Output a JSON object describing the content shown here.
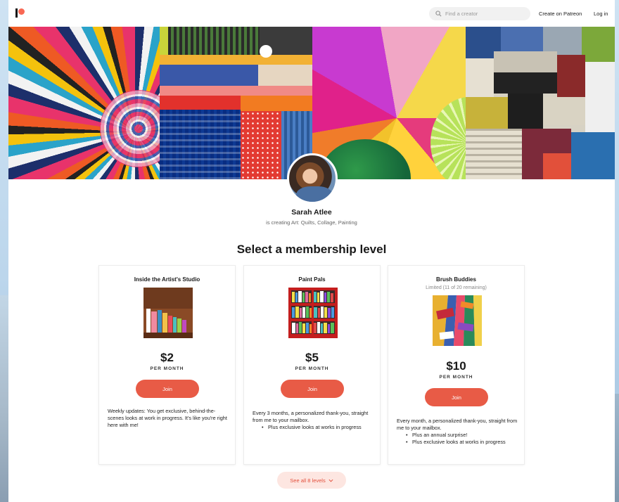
{
  "header": {
    "search_placeholder": "Find a creator",
    "create_label": "Create on Patreon",
    "login_label": "Log in"
  },
  "creator": {
    "name": "Sarah Atlee",
    "tagline": "is creating Art: Quilts, Collage, Painting"
  },
  "section_title": "Select a membership level",
  "tiers": [
    {
      "name": "Inside the Artist's Studio",
      "limited": "",
      "price": "$2",
      "per": "PER MONTH",
      "join": "Join",
      "description": "Weekly updates: You get exclusive, behind-the-scenes looks at work in progress. It's like you're right here with me!",
      "bullets": []
    },
    {
      "name": "Paint Pals",
      "limited": "",
      "price": "$5",
      "per": "PER MONTH",
      "join": "Join",
      "description": "Every 3 months, a personalized thank-you, straight from me to your mailbox.",
      "bullets": [
        "Plus exclusive looks at works in progress"
      ]
    },
    {
      "name": "Brush Buddies",
      "limited": "Limited (11 of 20 remaining)",
      "price": "$10",
      "per": "PER MONTH",
      "join": "Join",
      "description": "Every month, a personalized thank-you, straight from me to your mailbox.",
      "bullets": [
        "Plus an annual surprise!",
        "Plus exclusive looks at works in progress"
      ]
    }
  ],
  "see_all_label": "See all 8 levels",
  "icons": {
    "logo": "patreon-logo",
    "search": "search-icon",
    "see_all": "chevron-down-icon"
  },
  "colors": {
    "accent": "#e85b46",
    "brand": "#f96854",
    "see_all_bg": "#fde6e1"
  }
}
